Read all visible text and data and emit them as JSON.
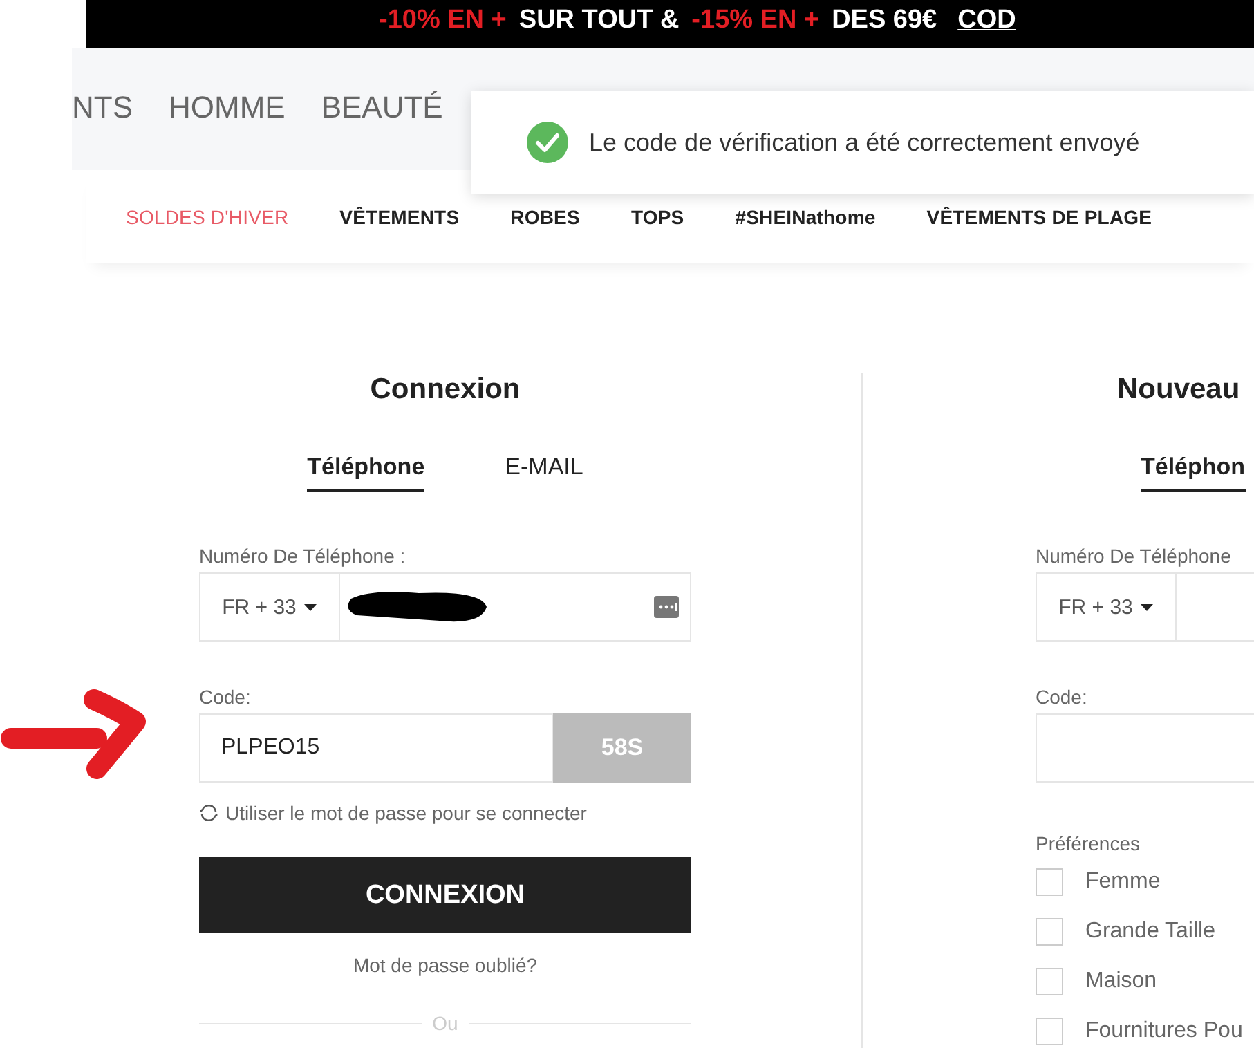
{
  "promo_banner": {
    "segments": [
      {
        "text": "-10% EN +",
        "kind": "highlight"
      },
      {
        "text": "SUR TOUT &",
        "kind": "plain"
      },
      {
        "text": "-15% EN +",
        "kind": "highlight"
      },
      {
        "text": "DES 69€",
        "kind": "plain"
      },
      {
        "text": "COD",
        "kind": "link"
      }
    ]
  },
  "categories": [
    "NTS",
    "HOMME",
    "BEAUTÉ"
  ],
  "nav": [
    {
      "label": "SOLDES D'HIVER",
      "kind": "sale"
    },
    {
      "label": "VÊTEMENTS",
      "kind": "plain"
    },
    {
      "label": "ROBES",
      "kind": "plain"
    },
    {
      "label": "TOPS",
      "kind": "plain"
    },
    {
      "label": "#SHEINathome",
      "kind": "marked"
    },
    {
      "label": "VÊTEMENTS DE PLAGE",
      "kind": "plain"
    }
  ],
  "toast": {
    "kind": "success",
    "message": "Le code de vérification a été correctement envoyé"
  },
  "login": {
    "title": "Connexion",
    "tabs": [
      {
        "label": "Téléphone",
        "selected": true
      },
      {
        "label": "E-MAIL",
        "selected": false
      }
    ],
    "phone": {
      "label": "Numéro De Téléphone :",
      "country": "FR + 33",
      "redacted": true
    },
    "code": {
      "label": "Code:",
      "value": "PLPEO15",
      "timer": "58S",
      "timer_disabled": true
    },
    "switch_link": "Utiliser le mot de passe pour se connecter",
    "submit": "CONNEXION",
    "forgot": "Mot de passe oublié?",
    "divider": "Ou"
  },
  "register": {
    "title": "Nouveau",
    "tabs": [
      {
        "label": "Téléphon",
        "selected": true
      }
    ],
    "phone": {
      "label": "Numéro De Téléphone",
      "country": "FR + 33"
    },
    "code": {
      "label": "Code:"
    },
    "preferences": {
      "label": "Préférences",
      "options": [
        {
          "label": "Femme",
          "checked": false
        },
        {
          "label": "Grande Taille",
          "checked": false
        },
        {
          "label": "Maison",
          "checked": false
        },
        {
          "label": "Fournitures Pou",
          "checked": false
        }
      ]
    }
  }
}
